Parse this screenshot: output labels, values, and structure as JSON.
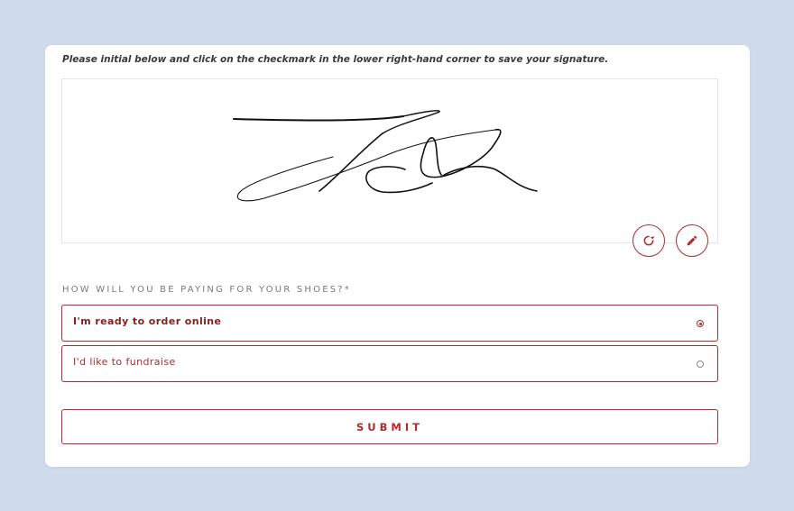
{
  "form": {
    "instruction": "Please initial below and click on the checkmark in the lower right-hand corner to save your signature.",
    "signature_pad": {
      "redo_icon": "redo-icon",
      "edit_icon": "pencil-icon"
    },
    "question": "HOW WILL YOU BE PAYING FOR YOUR SHOES?*",
    "options": [
      {
        "label": "I'm ready to order online",
        "selected": true
      },
      {
        "label": "I'd like to fundraise",
        "selected": false
      }
    ],
    "submit_label": "SUBMIT"
  },
  "colors": {
    "page_background": "#cfdbeb",
    "card_background": "#ffffff",
    "accent": "#b22a2e"
  }
}
